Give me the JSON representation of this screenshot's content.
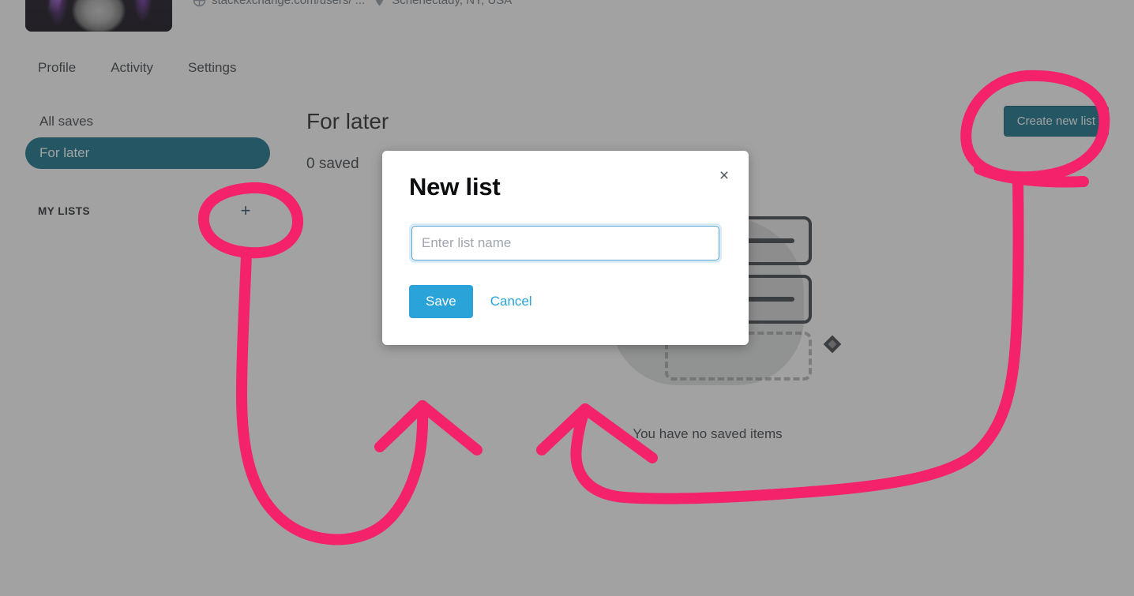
{
  "profile": {
    "avatar_alt": "user-avatar-cat",
    "website": "stackexchange.com/users/ ...",
    "location": "Schenectady, NY, USA",
    "website_icon": "globe-icon",
    "location_icon": "map-pin-icon"
  },
  "tabs": [
    {
      "label": "Profile"
    },
    {
      "label": "Activity"
    },
    {
      "label": "Settings"
    }
  ],
  "sidebar": {
    "items": [
      {
        "label": "All saves",
        "active": false
      },
      {
        "label": "For later",
        "active": true
      }
    ],
    "my_lists_label": "MY LISTS",
    "add_list_icon": "plus-icon",
    "add_list_glyph": "+"
  },
  "main": {
    "title": "For later",
    "saved_count": "0 saved",
    "create_button": "Create new list"
  },
  "empty_state": {
    "text": "You have no saved items",
    "plus_glyph": "+"
  },
  "modal": {
    "title": "New list",
    "close_icon": "close-icon",
    "close_glyph": "×",
    "input_value": "",
    "input_placeholder": "Enter list name",
    "save_label": "Save",
    "cancel_label": "Cancel"
  },
  "colors": {
    "accent_teal": "#0e6e86",
    "accent_blue": "#2aa3d8",
    "annotation_pink": "#f4216b",
    "overlay_gray": "#858585",
    "text_dark": "#232629"
  }
}
